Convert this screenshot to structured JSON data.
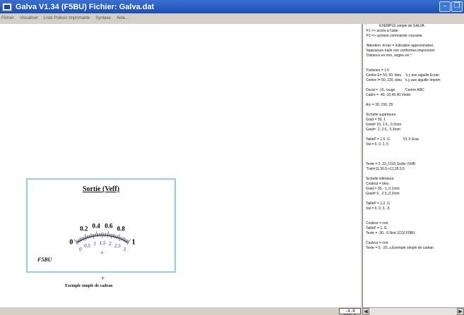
{
  "window": {
    "title": "Galva  V1.34  (F5BU)   Fichier: Galva.dat"
  },
  "menu": [
    "Fichier",
    "Visualiser",
    "Liste Polices Imprimante",
    "Syntaxe",
    "Aide..."
  ],
  "dial": {
    "title": "Sortie (Veff)",
    "upper_ticks": [
      "0",
      "0.2",
      "0.4",
      "0.6",
      "0.8",
      "1"
    ],
    "lower_ticks": [
      "0",
      "0.5",
      "1",
      "1.5",
      "2",
      "2.5",
      "3"
    ],
    "signature": "F5BU",
    "caption": "Exemple simple de cadran",
    "upper_color": "#000000",
    "lower_color": "#1a1aa0",
    "frame_color": "#8fd0e8"
  },
  "status": {
    "coords": "-4.8  328.1"
  },
  "script_lines": [
    "'             EXEMPLE simple de GALVA",
    "'F1 => accès à l'aide",
    "'F2 => syntaxe commande courante",
    "",
    "'Attention: écran = indication approximative,",
    "'épaisseurs traits non conformes impression",
    "'Distance en mm, angles en °",
    "",
    "",
    "'Facteurs = 1.5",
    "Centre E= 50, 50, bleu    'x,y axe aiguille Ecran",
    "Centre I= 50, 220, bleu   'x,y axe aiguille Imprim",
    "",
    "Decal = -15, rouge          'Centre ARC",
    "Cadre = -40,-10,40,40,Violet",
    "",
    "Arc = 30, 150, 25",
    "",
    "'Echelle supérieure",
    "Grad = 50, 1",
    "Grad= 10, 1.5,, 0.2mm",
    "Grad=  2, 2.5,, 0.3mm",
    "",
    "TailleP = 1.5, G             'V1.5 Grac",
    "Val = 5, 0, 1, 5",
    "",
    "",
    "",
    "Texte = 0, 33,,CGS,Sortie (Veff)",
    "'Trait=11,30.5,+11,30.5,5",
    "",
    "'Echelle inférieure",
    "Couleur = bleu",
    "Grad = 30, -1,,0.1mm",
    "Grad= 6, -2.5,,0.2mm",
    "",
    "TailleP = 1.2, G",
    "Val = 6, 0, 3, -5",
    "",
    "",
    "Couleur = noir",
    "TailleP = 1, G",
    "Texte = -30, -5,Noir,1CGI,F5BU",
    "",
    "Couleur = noir",
    "Texte = 0, -20,,s,Exemple simple de cadran"
  ]
}
